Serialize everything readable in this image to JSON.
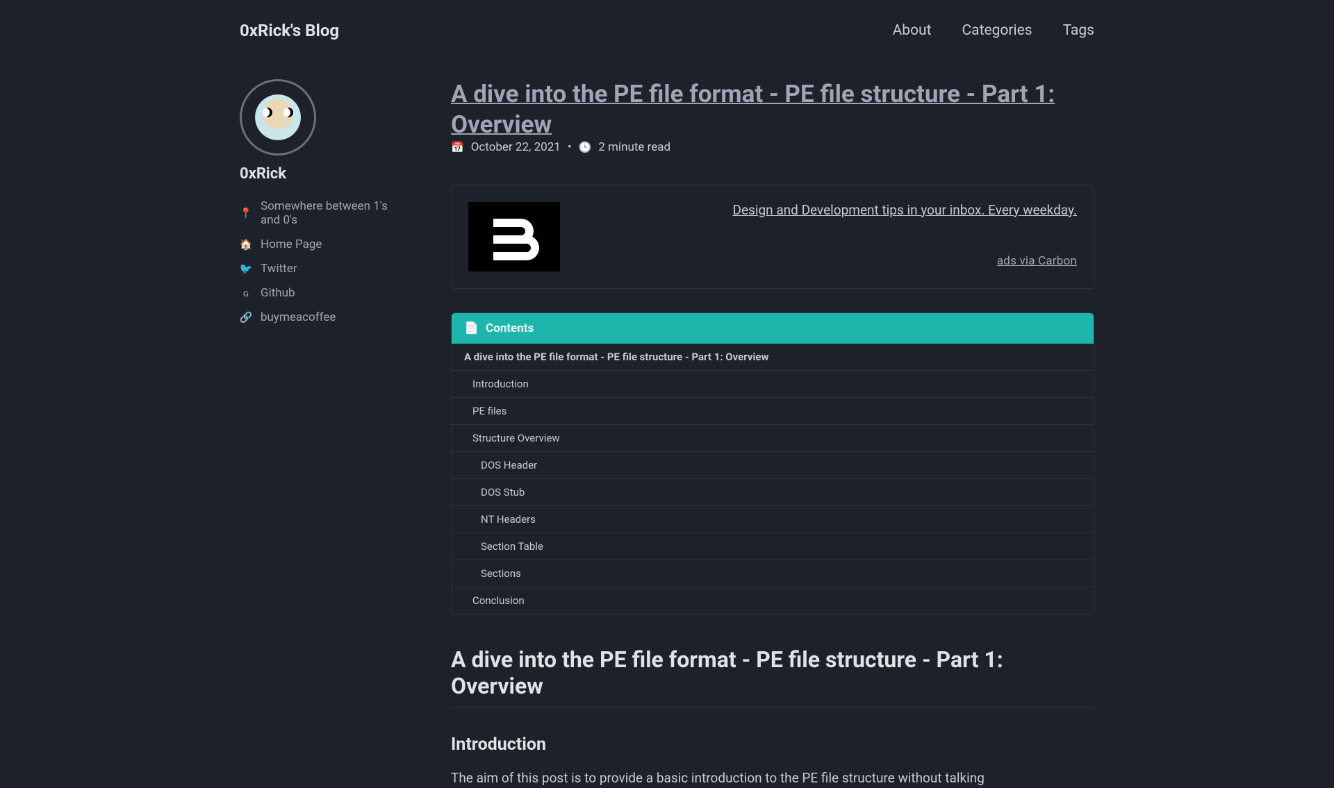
{
  "header": {
    "site_title": "0xRick's Blog",
    "nav": [
      {
        "label": "About"
      },
      {
        "label": "Categories"
      },
      {
        "label": "Tags"
      }
    ]
  },
  "sidebar": {
    "author": "0xRick",
    "items": [
      {
        "icon": "📍",
        "label": "Somewhere between 1's and 0's",
        "link": false
      },
      {
        "icon": "🏠",
        "label": "Home Page",
        "link": true
      },
      {
        "icon": "🐦",
        "label": "Twitter",
        "link": true
      },
      {
        "icon": "ɢ",
        "label": "Github",
        "link": true
      },
      {
        "icon": "🔗",
        "label": "buymeacoffee",
        "link": true
      }
    ]
  },
  "post": {
    "title": "A dive into the PE file format - PE file structure - Part 1: Overview",
    "date": "October 22, 2021",
    "read_time": "2 minute read"
  },
  "carbon": {
    "tagline": "Design and Development tips in your inbox. Every weekday.",
    "via": "ads via Carbon"
  },
  "toc": {
    "header": "Contents",
    "items": [
      {
        "level": 1,
        "label": "A dive into the PE file format - PE file structure - Part 1: Overview"
      },
      {
        "level": 2,
        "label": "Introduction"
      },
      {
        "level": 2,
        "label": "PE files"
      },
      {
        "level": 2,
        "label": "Structure Overview"
      },
      {
        "level": 3,
        "label": "DOS Header"
      },
      {
        "level": 3,
        "label": "DOS Stub"
      },
      {
        "level": 3,
        "label": "NT Headers"
      },
      {
        "level": 3,
        "label": "Section Table"
      },
      {
        "level": 3,
        "label": "Sections"
      },
      {
        "level": 2,
        "label": "Conclusion"
      }
    ]
  },
  "article": {
    "h1": "A dive into the PE file format - PE file structure - Part 1: Overview",
    "h2_intro": "Introduction",
    "intro_text": "The aim of this post is to provide a basic introduction to the PE file structure without talking"
  }
}
